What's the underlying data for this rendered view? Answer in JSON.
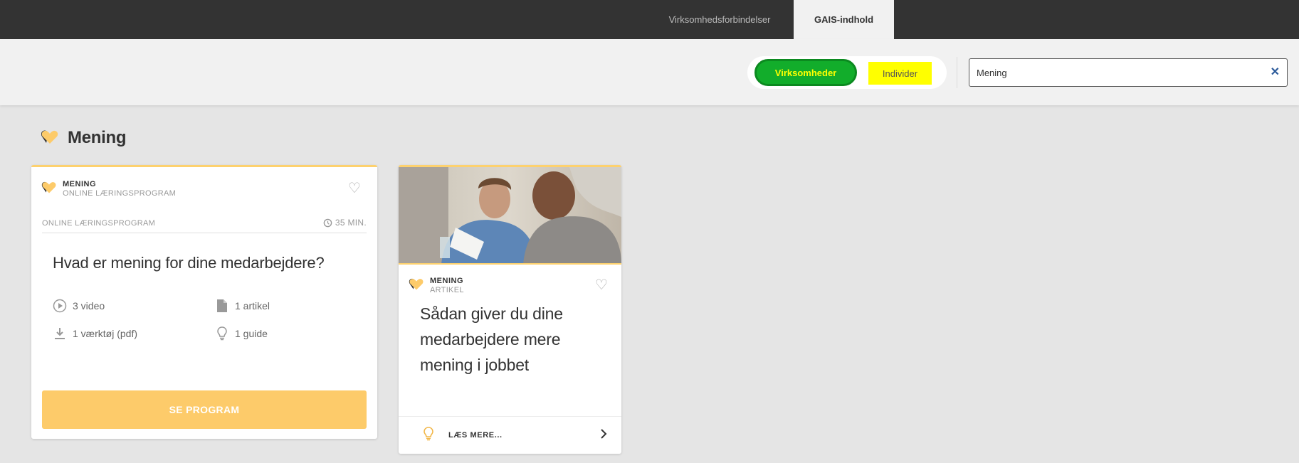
{
  "nav": {
    "tabs": [
      {
        "label": "Virksomhedsforbindelser",
        "active": false
      },
      {
        "label": "GAIS-indhold",
        "active": true
      }
    ]
  },
  "filter": {
    "toggle_companies": "Virksomheder",
    "toggle_individuals": "Individer",
    "search_value": "Mening",
    "clear_icon": "close-icon"
  },
  "section": {
    "title": "Mening",
    "icon": "heart-icon"
  },
  "cards": [
    {
      "category": "MENING",
      "subcategory": "ONLINE LÆRINGSPROGRAM",
      "type_label": "ONLINE LÆRINGSPROGRAM",
      "duration": "35 MIN.",
      "title": "Hvad er mening for dine medarbejdere?",
      "resources": [
        {
          "icon": "play-icon",
          "label": "3 video"
        },
        {
          "icon": "document-icon",
          "label": "1 artikel"
        },
        {
          "icon": "download-icon",
          "label": "1 værktøj (pdf)"
        },
        {
          "icon": "lightbulb-icon",
          "label": "1 guide"
        }
      ],
      "cta": "SE PROGRAM"
    },
    {
      "category": "MENING",
      "subcategory": "ARTIKEL",
      "title": "Sådan giver du dine medarbejdere mere mening i jobbet",
      "cta": "LÆS MERE..."
    }
  ],
  "colors": {
    "topbar": "#333333",
    "accent_yellow": "#fdcb6a",
    "toggle_green": "#12ad2b",
    "highlight_yellow": "#ffff00"
  }
}
